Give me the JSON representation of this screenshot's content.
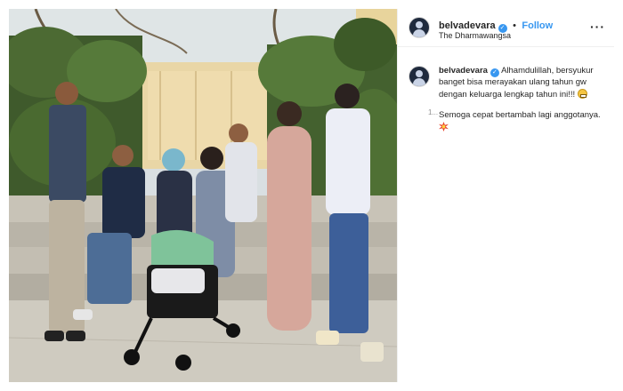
{
  "post": {
    "username": "belvadevara",
    "verified_icon": "verified-badge-icon",
    "separator": "•",
    "follow_label": "Follow",
    "location": "The Dharmawangsa",
    "more_icon": "more-options-icon",
    "more_glyph": "···"
  },
  "caption": {
    "username": "belvadevara",
    "line1": "Alhamdulillah, bersyukur banget bisa merayakan ulang tahun gw dengan keluarga lengkap tahun ini!!!",
    "line2": "Semoga cepat bertambah lagi anggotanya.",
    "meta": "1..."
  },
  "photo": {
    "icon": "family-photo",
    "colors": {
      "ivy": "#3f5a2c",
      "stone": "#b9b4a8",
      "sky": "#d9dfe2"
    }
  }
}
